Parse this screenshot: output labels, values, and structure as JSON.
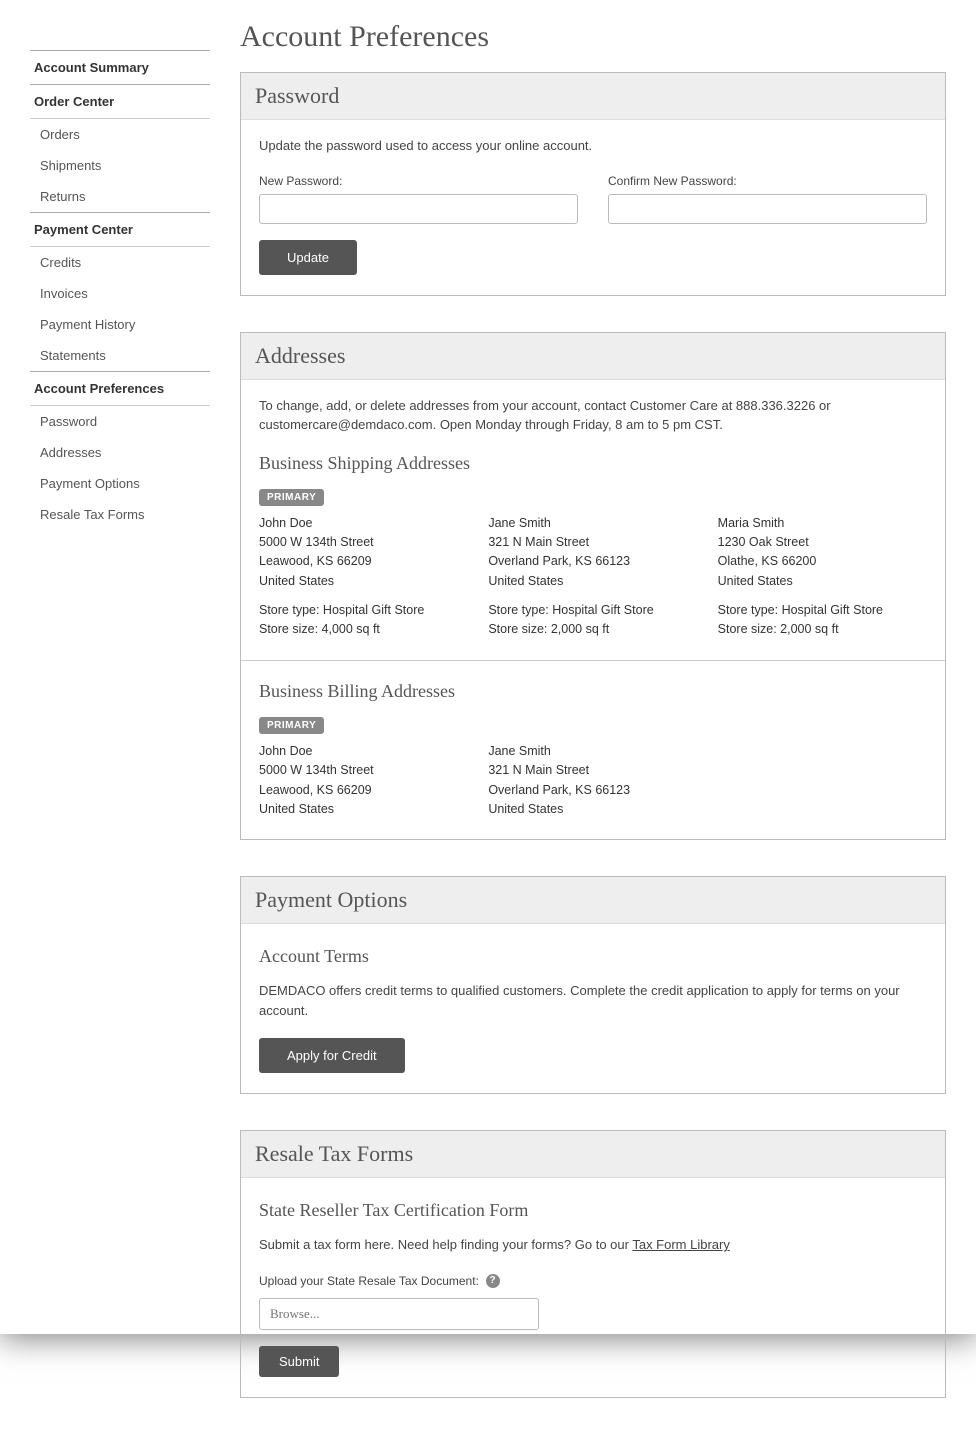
{
  "sidebar": {
    "sections": [
      {
        "header": "Account Summary",
        "items": []
      },
      {
        "header": "Order Center",
        "items": [
          "Orders",
          "Shipments",
          "Returns"
        ]
      },
      {
        "header": "Payment Center",
        "items": [
          "Credits",
          "Invoices",
          "Payment History",
          "Statements"
        ]
      },
      {
        "header": "Account Preferences",
        "items": [
          "Password",
          "Addresses",
          "Payment Options",
          "Resale Tax Forms"
        ]
      }
    ]
  },
  "page_title": "Account Preferences",
  "password": {
    "title": "Password",
    "desc": "Update the password used to access your online account.",
    "new_label": "New Password:",
    "confirm_label": "Confirm New Password:",
    "button": "Update"
  },
  "addresses": {
    "title": "Addresses",
    "desc": "To change, add, or delete addresses from your account, contact Customer Care at 888.336.3226 or customercare@demdaco.com. Open Monday through Friday, 8 am to 5 pm CST.",
    "shipping": {
      "title": "Business Shipping Addresses",
      "primary_badge": "PRIMARY",
      "items": [
        {
          "name": "John Doe",
          "line1": "5000 W 134th Street",
          "line2": "Leawood, KS 66209",
          "country": "United States",
          "store_type": "Store type: Hospital Gift Store",
          "store_size": "Store size: 4,000 sq ft"
        },
        {
          "name": "Jane Smith",
          "line1": "321 N Main Street",
          "line2": "Overland Park, KS 66123",
          "country": "United States",
          "store_type": "Store type: Hospital Gift Store",
          "store_size": "Store size: 2,000 sq ft"
        },
        {
          "name": "Maria Smith",
          "line1": "1230 Oak Street",
          "line2": "Olathe, KS 66200",
          "country": "United States",
          "store_type": "Store type: Hospital Gift Store",
          "store_size": "Store size: 2,000 sq ft"
        }
      ]
    },
    "billing": {
      "title": "Business Billing Addresses",
      "primary_badge": "PRIMARY",
      "items": [
        {
          "name": "John Doe",
          "line1": "5000 W 134th Street",
          "line2": "Leawood, KS 66209",
          "country": "United States"
        },
        {
          "name": "Jane Smith",
          "line1": "321 N Main Street",
          "line2": "Overland Park, KS 66123",
          "country": "United States"
        }
      ]
    }
  },
  "payment_options": {
    "title": "Payment Options",
    "terms_title": "Account Terms",
    "terms_desc": "DEMDACO offers credit terms to qualified customers. Complete the credit application to apply for terms on your account.",
    "apply_button": "Apply for Credit"
  },
  "tax_forms": {
    "title": "Resale Tax Forms",
    "form_title": "State Reseller Tax Certification Form",
    "submit_intro": "Submit a tax form here. Need help finding your forms? Go to our ",
    "library_link": "Tax Form Library",
    "upload_label": "Upload your State Resale Tax Document:",
    "browse_placeholder": "Browse...",
    "submit_button": "Submit"
  }
}
